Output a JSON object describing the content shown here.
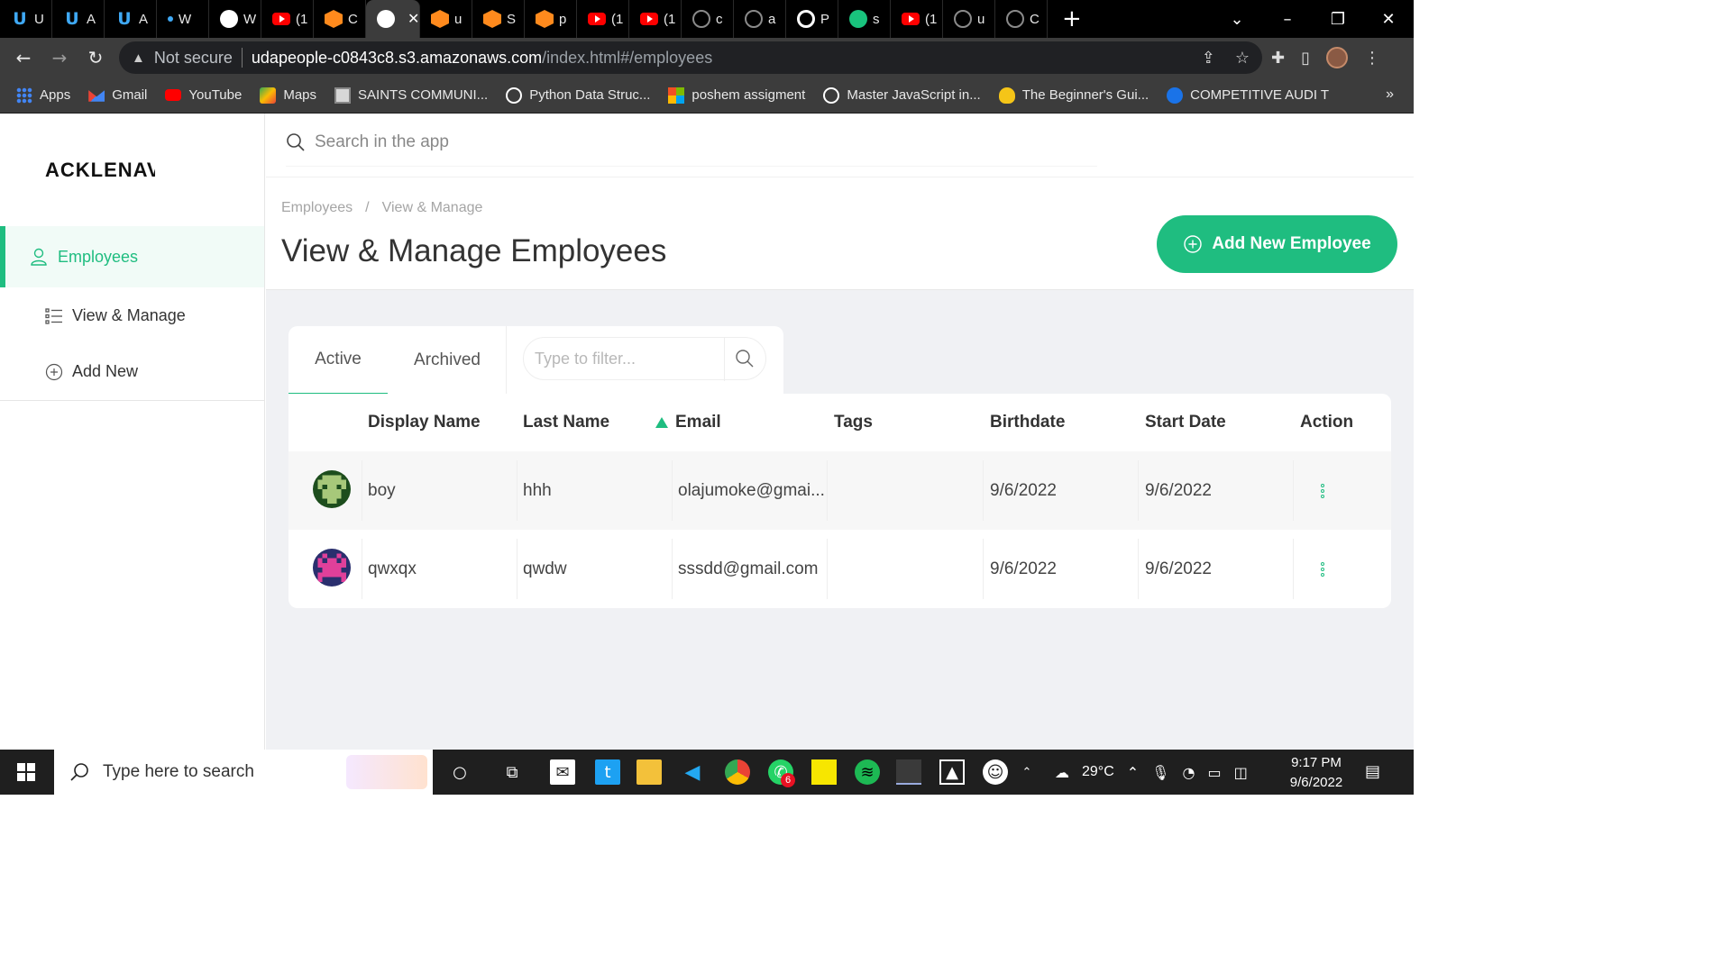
{
  "browser": {
    "tabs": [
      {
        "icon": "udacity-icon",
        "title": "U"
      },
      {
        "icon": "udacity-icon",
        "title": "A"
      },
      {
        "icon": "udacity-icon",
        "title": "A"
      },
      {
        "icon": "dot-icon",
        "title": "W"
      },
      {
        "icon": "globe-icon",
        "title": "W"
      },
      {
        "icon": "youtube-icon",
        "title": "(1"
      },
      {
        "icon": "aws-box-icon",
        "title": "C"
      },
      {
        "icon": "globe-icon",
        "title": "",
        "active": true
      },
      {
        "icon": "aws-box-icon",
        "title": "u"
      },
      {
        "icon": "aws-box-icon",
        "title": "S"
      },
      {
        "icon": "aws-box-icon",
        "title": "p"
      },
      {
        "icon": "youtube-icon",
        "title": "(1"
      },
      {
        "icon": "youtube-icon",
        "title": "(1"
      },
      {
        "icon": "github-icon",
        "title": "c"
      },
      {
        "icon": "github-icon",
        "title": "a"
      },
      {
        "icon": "ring-icon",
        "title": "P"
      },
      {
        "icon": "green-check-icon",
        "title": "s"
      },
      {
        "icon": "youtube-icon",
        "title": "(1"
      },
      {
        "icon": "github-icon",
        "title": "u"
      },
      {
        "icon": "github-icon",
        "title": "C"
      }
    ],
    "security_label": "Not secure",
    "url_host": "udapeople-c0843c8.s3.amazonaws.com",
    "url_path": "/index.html#/employees",
    "bookmarks": [
      {
        "icon": "apps-icon",
        "label": "Apps"
      },
      {
        "icon": "gmail-icon",
        "label": "Gmail"
      },
      {
        "icon": "youtube-icon",
        "label": "YouTube"
      },
      {
        "icon": "maps-icon",
        "label": "Maps"
      },
      {
        "icon": "saints-icon",
        "label": "SAINTS COMMUNI..."
      },
      {
        "icon": "wordpress-icon",
        "label": "Python  Data Struc..."
      },
      {
        "icon": "microsoft-icon",
        "label": "poshem assigment"
      },
      {
        "icon": "wordpress-icon",
        "label": "Master JavaScript in..."
      },
      {
        "icon": "handshake-icon",
        "label": "The Beginner's Gui..."
      },
      {
        "icon": "c-icon",
        "label": "COMPETITIVE AUDI T"
      }
    ],
    "bookmarks_more": "»"
  },
  "app": {
    "logo": "ACKLENAVE",
    "search_placeholder": "Search in the app",
    "sidebar": {
      "primary": "Employees",
      "items": [
        "View & Manage",
        "Add New"
      ]
    },
    "breadcrumb": [
      "Employees",
      "/",
      "View & Manage"
    ],
    "page_title": "View & Manage Employees",
    "add_button": "Add New Employee",
    "tabs": [
      "Active",
      "Archived"
    ],
    "filter_placeholder": "Type to filter...",
    "table": {
      "columns": [
        "Display Name",
        "Last Name",
        "Email",
        "Tags",
        "Birthdate",
        "Start Date",
        "Action"
      ],
      "sorted_column": "Email",
      "sort_direction": "ascending",
      "rows": [
        {
          "avatar": "green-pixel-avatar",
          "display_name": "boy",
          "last_name": "hhh",
          "email": "olajumoke@gmai...",
          "tags": "",
          "birthdate": "9/6/2022",
          "start_date": "9/6/2022"
        },
        {
          "avatar": "pink-pixel-avatar",
          "display_name": "qwxqx",
          "last_name": "qwdw",
          "email": "sssdd@gmail.com",
          "tags": "",
          "birthdate": "9/6/2022",
          "start_date": "9/6/2022"
        }
      ]
    },
    "accent_color": "#1fbd80"
  },
  "taskbar": {
    "search_placeholder": "Type here to search",
    "whatsapp_badge": "6",
    "weather": "29°C",
    "time": "9:17 PM",
    "date": "9/6/2022"
  }
}
